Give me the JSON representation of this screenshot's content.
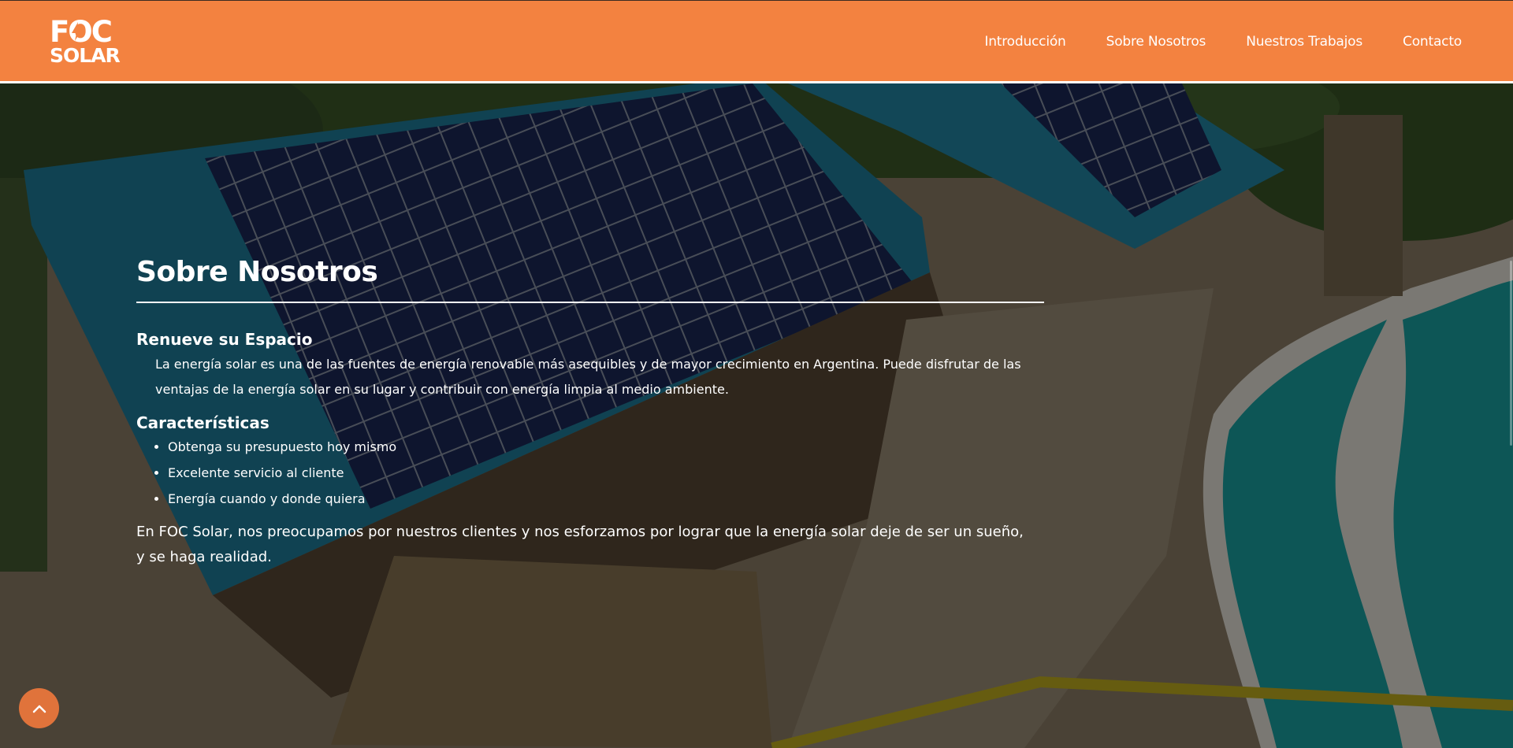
{
  "brand": {
    "logo_line1": "FOC",
    "logo_line2": "SOLAR",
    "logo_icon": "lightning-bolt-icon"
  },
  "nav": {
    "items": [
      "Introducción",
      "Sobre Nosotros",
      "Nuestros Trabajos",
      "Contacto"
    ]
  },
  "colors": {
    "header_bg": "#f38240",
    "accent": "#e0733b",
    "text": "#ffffff"
  },
  "main": {
    "title": "Sobre Nosotros",
    "section1": {
      "heading": "Renueve su Espacio",
      "text": "La energía solar es una de las fuentes de energía renovable más asequibles y de mayor crecimiento en Argentina. Puede disfrutar de las ventajas de la energía solar en su lugar y contribuir con energía limpia al medio ambiente."
    },
    "section2": {
      "heading": "Características",
      "items": [
        "Obtenga su presupuesto hoy mismo",
        "Excelente servicio al cliente",
        "Energía cuando y donde quiera"
      ]
    },
    "closing": "En FOC Solar, nos preocupamos por nuestros clientes y nos esforzamos por lograr que la energía solar deje de ser un sueño, y se haga realidad."
  },
  "scroll_top": {
    "icon": "chevron-up-icon"
  }
}
